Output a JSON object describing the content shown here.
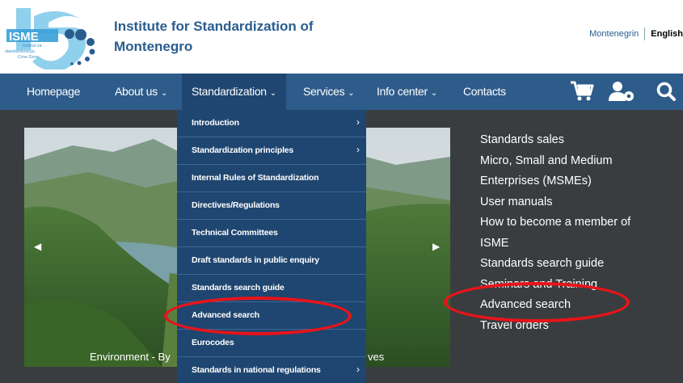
{
  "header": {
    "logo_text": "ISME",
    "logo_subtext": [
      "Institut za",
      "standardizaciju",
      "Crne Gore"
    ],
    "title_line1": "Institute for Standardization of",
    "title_line2": "Montenegro",
    "languages": [
      "Montenegrin",
      "English"
    ],
    "active_language": "English"
  },
  "nav": {
    "items": [
      "Homepage",
      "About us",
      "Standardization",
      "Services",
      "Info center",
      "Contacts"
    ],
    "chevron": "⌄",
    "icons": [
      "cart-icon",
      "users-settings-icon",
      "search-icon"
    ]
  },
  "dropdown": {
    "items": [
      {
        "label": "Introduction",
        "has_sub": true
      },
      {
        "label": "Standardization principles",
        "has_sub": true
      },
      {
        "label": "Internal Rules of Standardization",
        "has_sub": false
      },
      {
        "label": "Directives/Regulations",
        "has_sub": false
      },
      {
        "label": "Technical Committees",
        "has_sub": false
      },
      {
        "label": "Draft standards in public enquiry",
        "has_sub": false
      },
      {
        "label": "Standards search guide",
        "has_sub": false
      },
      {
        "label": "Advanced search",
        "has_sub": false
      },
      {
        "label": "Eurocodes",
        "has_sub": false
      },
      {
        "label": "Standards in national regulations",
        "has_sub": true
      }
    ],
    "sub_arrow": "›"
  },
  "slider": {
    "caption_left": "Environment - By",
    "caption_right": "ves",
    "prev": "◀",
    "next": "▶"
  },
  "side_links": [
    "Standards sales",
    "Micro, Small and Medium",
    "Enterprises (MSMEs)",
    "User manuals",
    "How to become a member of",
    "ISME",
    "Standards search guide",
    "Seminars and Training",
    "Advanced search",
    "Travel orders"
  ],
  "colors": {
    "nav_bg": "#2e5c8a",
    "dropdown_bg": "#1f4670",
    "title": "#2a5d8f",
    "highlight_oval": "#e8141a",
    "body_bg": "#3a3d40"
  }
}
